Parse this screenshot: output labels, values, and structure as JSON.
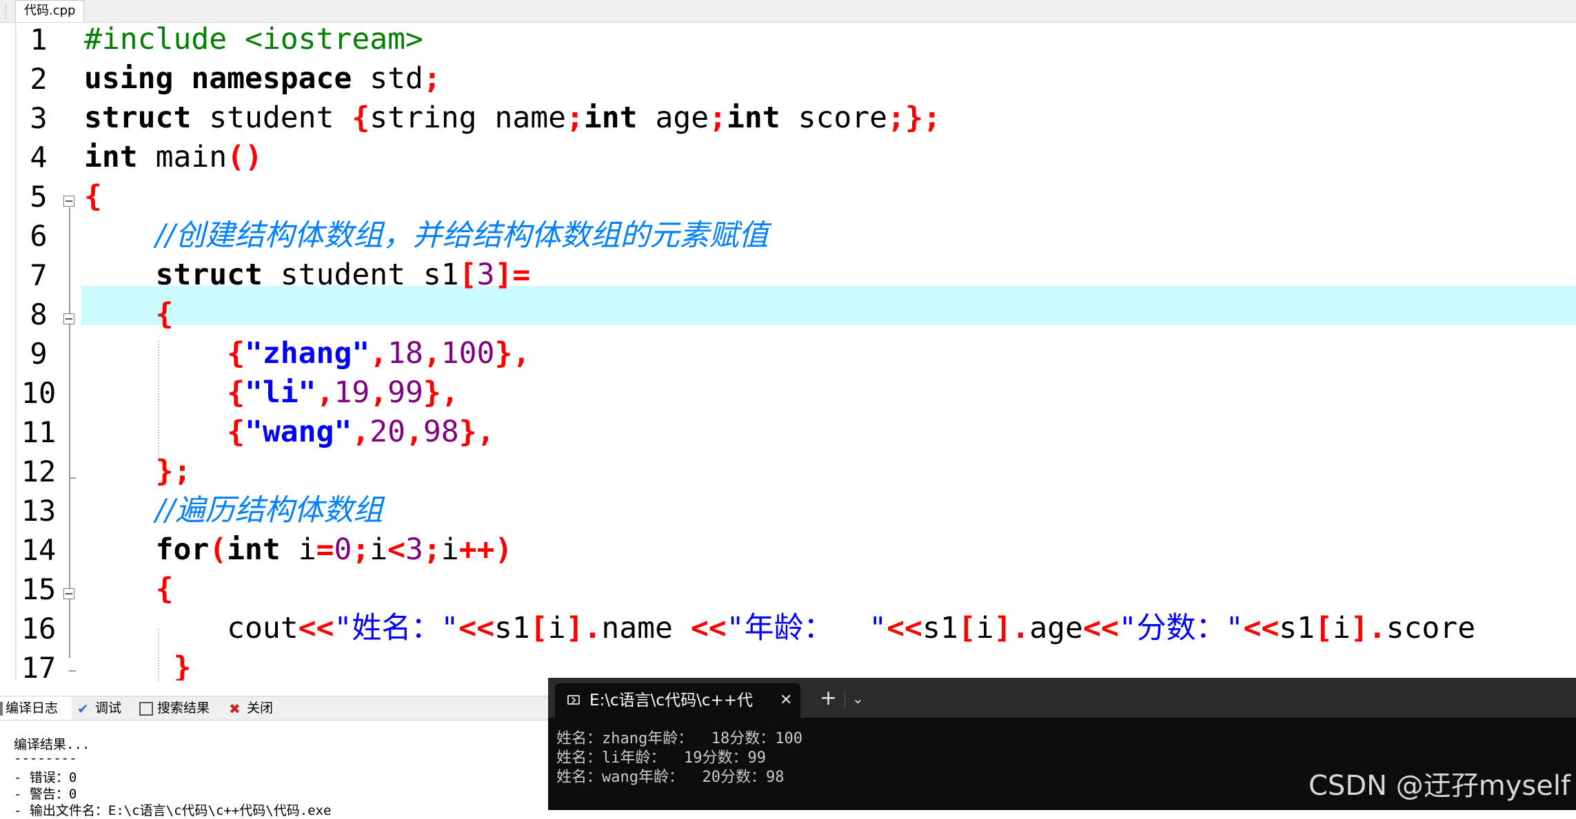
{
  "editor": {
    "tab_label": "代码.cpp",
    "line_numbers": [
      "1",
      "2",
      "3",
      "4",
      "5",
      "6",
      "7",
      "8",
      "9",
      "10",
      "11",
      "12",
      "13",
      "14",
      "15",
      "16",
      "17"
    ],
    "current_line": "11"
  },
  "code": {
    "l1_a": "#include <iostream>",
    "l2_kw1": "using",
    "l2_kw2": "namespace",
    "l2_id": "std",
    "l2_semi": ";",
    "l3_kw": "struct",
    "l3_id": "student",
    "l3_open": "{",
    "l3_id2": "string name",
    "l3_s1": ";",
    "l3_kw2": "int",
    "l3_id3": "age",
    "l3_s2": ";",
    "l3_kw3": "int",
    "l3_id4": "score",
    "l3_s3": ";",
    "l3_close": "};",
    "l4_kw": "int",
    "l4_id": "main",
    "l4_paren": "()",
    "l5": "{",
    "l6_comment": "//创建结构体数组，并给结构体数组的元素赋值",
    "l7_kw": "struct",
    "l7_id": "student s1",
    "l7_lb": "[",
    "l7_num": "3",
    "l7_rb": "]=",
    "l8": "{",
    "l9_open": "{",
    "l9_str": "\"zhang\"",
    "l9_c1": ",",
    "l9_n1": "18",
    "l9_c2": ",",
    "l9_n2": "100",
    "l9_close": "},",
    "l10_open": "{",
    "l10_str": "\"li\"",
    "l10_c1": ",",
    "l10_n1": "19",
    "l10_c2": ",",
    "l10_n2": "99",
    "l10_close": "},",
    "l11_open": "{",
    "l11_str": "\"wang\"",
    "l11_c1": ",",
    "l11_n1": "20",
    "l11_c2": ",",
    "l11_n2": "98",
    "l11_close": "},",
    "l12": "};",
    "l13_comment": "//遍历结构体数组",
    "l14_kw": "for",
    "l14_p": "(",
    "l14_kw2": "int",
    "l14_id": "i",
    "l14_eq": "=",
    "l14_n0": "0",
    "l14_s1": ";",
    "l14_id2": "i",
    "l14_lt": "<",
    "l14_n3": "3",
    "l14_s2": ";",
    "l14_id3": "i",
    "l14_pp": "++)",
    "l15": "{",
    "l16_cout": "cout",
    "l16_op1": "<<",
    "l16_str1": "\"姓名：\"",
    "l16_op2": "<<",
    "l16_s1a": "s1",
    "l16_lb1": "[",
    "l16_i1": "i",
    "l16_rb1": "].",
    "l16_name": "name ",
    "l16_op3": "<<",
    "l16_str2": "\"年龄：  \"",
    "l16_op4": "<<",
    "l16_s1b": "s1",
    "l16_lb2": "[",
    "l16_i2": "i",
    "l16_rb2": "].",
    "l16_age": "age",
    "l16_op5": "<<",
    "l16_str3": "\"分数：\"",
    "l16_op6": "<<",
    "l16_s1c": "s1",
    "l16_lb3": "[",
    "l16_i3": "i",
    "l16_rb3": "].",
    "l16_score": "score",
    "l17": "}"
  },
  "panel": {
    "tabs": [
      "编译日志",
      "调试",
      "搜索结果",
      "关闭"
    ],
    "log": [
      "编译结果...",
      "--------",
      "- 错误：0",
      "- 警告：0",
      "- 输出文件名：E:\\c语言\\c代码\\c++代码\\代码.exe"
    ]
  },
  "terminal": {
    "title": "E:\\c语言\\c代码\\c++代",
    "close": "✕",
    "new_tab": "+",
    "dropdown": "⌄",
    "output": [
      "姓名：zhang年龄：  18分数：100",
      "姓名：li年龄：  19分数：99",
      "姓名：wang年龄：  20分数：98"
    ]
  },
  "watermark": "CSDN @迂孖myself",
  "colors": {
    "keyword": "#000000",
    "preprocessor": "#008000",
    "operator": "#ff0000",
    "number": "#800080",
    "string": "#0000ff",
    "comment": "#0080ff",
    "current_line_bg": "#ccfbff",
    "terminal_bg": "#0c0c0c"
  }
}
